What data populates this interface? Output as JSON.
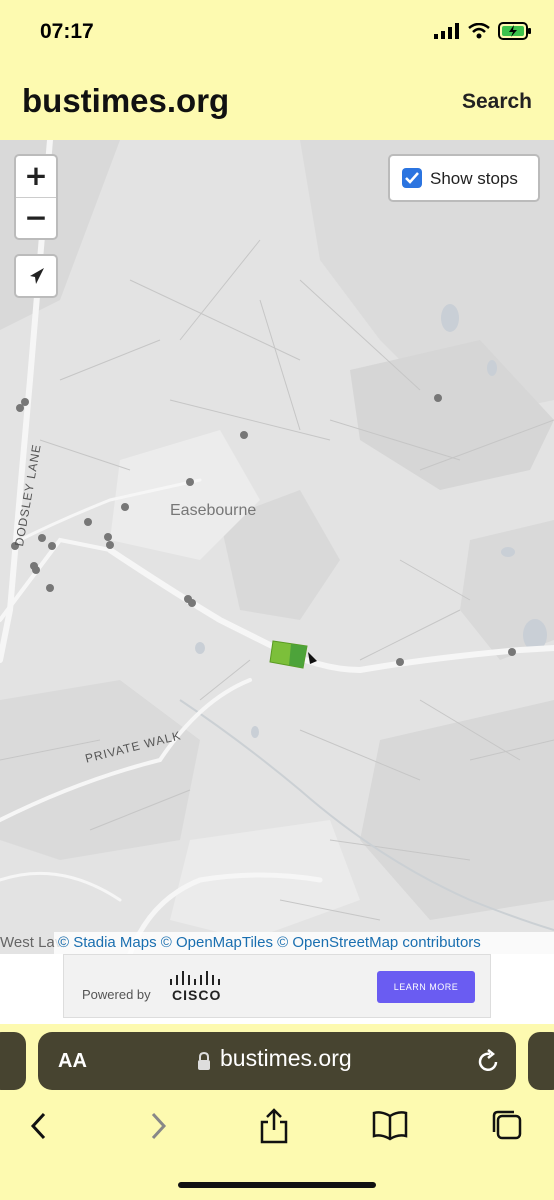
{
  "status_bar": {
    "time": "07:17"
  },
  "header": {
    "title": "bustimes.org",
    "search_label": "Search"
  },
  "map": {
    "zoom_in_label": "+",
    "zoom_out_label": "−",
    "show_stops_label": "Show stops",
    "show_stops_checked": true,
    "labels": {
      "dodsley_lane": "DODSLEY LANE",
      "easebourne": "Easebourne",
      "private_walk": "PRIVATE WALK",
      "west_lavington": "West Lavi"
    },
    "attribution": "© Stadia Maps © OpenMapTiles © OpenStreetMap contributors",
    "vehicle_color": "#7cbf3a"
  },
  "ad": {
    "powered_by": "Powered by",
    "brand": "CISCO",
    "cta": "LEARN MORE"
  },
  "browser": {
    "aa_label": "AA",
    "url": "bustimes.org"
  },
  "colors": {
    "header_bg": "#fdfab0",
    "browser_bar": "#474430",
    "accent": "#2b74e0"
  }
}
